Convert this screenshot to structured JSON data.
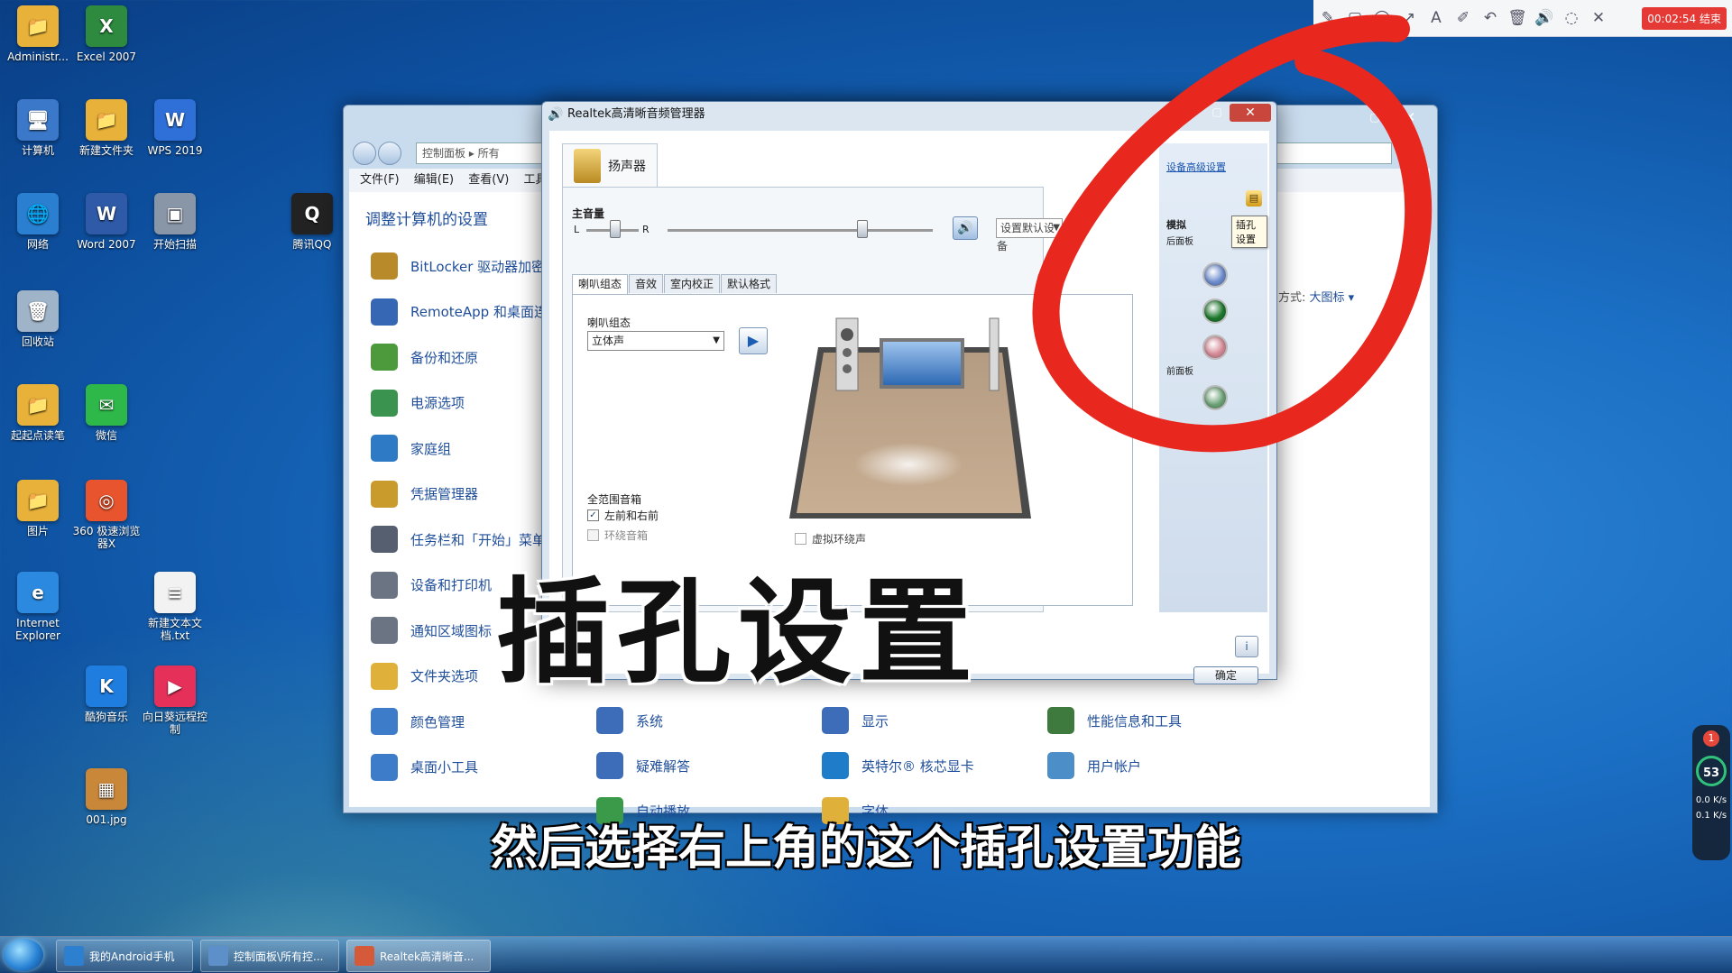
{
  "desktop_icons": [
    {
      "label": "Administr...",
      "color": "#e8b23a",
      "glyph": "📁"
    },
    {
      "label": "Excel 2007",
      "color": "#2d8a3e",
      "glyph": "X"
    },
    {
      "label": "计算机",
      "color": "#3b78c9",
      "glyph": "🖥"
    },
    {
      "label": "新建文件夹",
      "color": "#e8b23a",
      "glyph": "📁"
    },
    {
      "label": "WPS 2019",
      "color": "#2e6fd8",
      "glyph": "W"
    },
    {
      "label": "网络",
      "color": "#2a7fd0",
      "glyph": "🌐"
    },
    {
      "label": "Word 2007",
      "color": "#2e5aa8",
      "glyph": "W"
    },
    {
      "label": "开始扫描",
      "color": "#8896a8",
      "glyph": "▣"
    },
    {
      "label": "腾讯QQ",
      "color": "#222222",
      "glyph": "Q"
    },
    {
      "label": "回收站",
      "color": "#9fb4c8",
      "glyph": "🗑"
    },
    {
      "label": "起起点读笔",
      "color": "#e8b23a",
      "glyph": "📁"
    },
    {
      "label": "微信",
      "color": "#2fb84a",
      "glyph": "✉"
    },
    {
      "label": "图片",
      "color": "#e8b23a",
      "glyph": "📁"
    },
    {
      "label": "360 极速浏览器X",
      "color": "#e7542e",
      "glyph": "◎"
    },
    {
      "label": "Internet Explorer",
      "color": "#2b8ae0",
      "glyph": "e"
    },
    {
      "label": "新建文本文档.txt",
      "color": "#f2f2f2",
      "glyph": "≡"
    },
    {
      "label": "酷狗音乐",
      "color": "#1f7de0",
      "glyph": "K"
    },
    {
      "label": "向日葵远程控制",
      "color": "#e5305a",
      "glyph": "▶"
    },
    {
      "label": "001.jpg",
      "color": "#c9873a",
      "glyph": "▦"
    }
  ],
  "control_panel": {
    "address": "控制面板 ▸ 所有",
    "menu": [
      "文件(F)",
      "编辑(E)",
      "查看(V)",
      "工具(T)"
    ],
    "heading": "调整计算机的设置",
    "view_by_prefix": "方式:",
    "view_by_value": "大图标 ▾",
    "items_col1": [
      {
        "label": "BitLocker 驱动器加密",
        "color": "#b98a2a"
      },
      {
        "label": "RemoteApp 和桌面连接",
        "color": "#3567b5"
      },
      {
        "label": "备份和还原",
        "color": "#4c9a3c"
      },
      {
        "label": "电源选项",
        "color": "#3a9450"
      },
      {
        "label": "家庭组",
        "color": "#2f7ac4"
      },
      {
        "label": "凭据管理器",
        "color": "#c99b2c"
      },
      {
        "label": "任务栏和「开始」菜单",
        "color": "#555f70"
      },
      {
        "label": "设备和打印机",
        "color": "#6b7482"
      },
      {
        "label": "通知区域图标",
        "color": "#6b7482"
      },
      {
        "label": "文件夹选项",
        "color": "#e0b13a"
      },
      {
        "label": "颜色管理",
        "color": "#3d7cc8"
      },
      {
        "label": "桌面小工具",
        "color": "#3d7cc8"
      }
    ],
    "items_row_bottom": [
      {
        "label": "系统",
        "color": "#3d6cb8"
      },
      {
        "label": "显示",
        "color": "#3d6cb8"
      },
      {
        "label": "性能信息和工具",
        "color": "#3e7a3e"
      },
      {
        "label": "疑难解答",
        "color": "#3d6cb8"
      },
      {
        "label": "英特尔® 核芯显卡",
        "color": "#1f7cc8"
      },
      {
        "label": "用户帐户",
        "color": "#4c8fc8"
      },
      {
        "label": "自动播放",
        "color": "#3b9a4a"
      },
      {
        "label": "字体",
        "color": "#e0b13a"
      }
    ]
  },
  "realtek": {
    "title": "Realtek高清晰音频管理器",
    "device_tab": "扬声器",
    "volume_label": "主音量",
    "balance_left": "L",
    "balance_right": "R",
    "default_device": "设置默认设备",
    "subtabs": [
      "喇叭组态",
      "音效",
      "室内校正",
      "默认格式"
    ],
    "config_label": "喇叭组态",
    "config_value": "立体声",
    "fullrange_label": "全范围音箱",
    "front_lr": "左前和右前",
    "surround": "环绕音箱",
    "virtual_surround": "虚拟环绕声",
    "advanced_link": "设备高级设置",
    "analog": "模拟",
    "rear_panel": "后面板",
    "front_panel": "前面板",
    "tooltip": "插孔设置",
    "ok": "确定",
    "jack_colors": [
      "#6f8fd0",
      "#1e7a2e",
      "#d88d9a",
      "#6fa57a"
    ]
  },
  "recorder": {
    "timer": "00:02:54 结束",
    "tools": [
      "✎",
      "▢",
      "◯",
      "↗",
      "A",
      "✐",
      "↶",
      "🗑",
      "🔊",
      "◌",
      "✕"
    ]
  },
  "overlay": {
    "big_caption": "插孔设置",
    "subtitle": "然后选择右上角的这个插孔设置功能",
    "annotation_color": "#e8281e"
  },
  "net_monitor": {
    "badge": "1",
    "percent": "53",
    "up": "0.0 K/s",
    "down": "0.1 K/s"
  },
  "taskbar": {
    "tasks": [
      "我的Android手机",
      "控制面板\\所有控...",
      "Realtek高清晰音..."
    ]
  }
}
